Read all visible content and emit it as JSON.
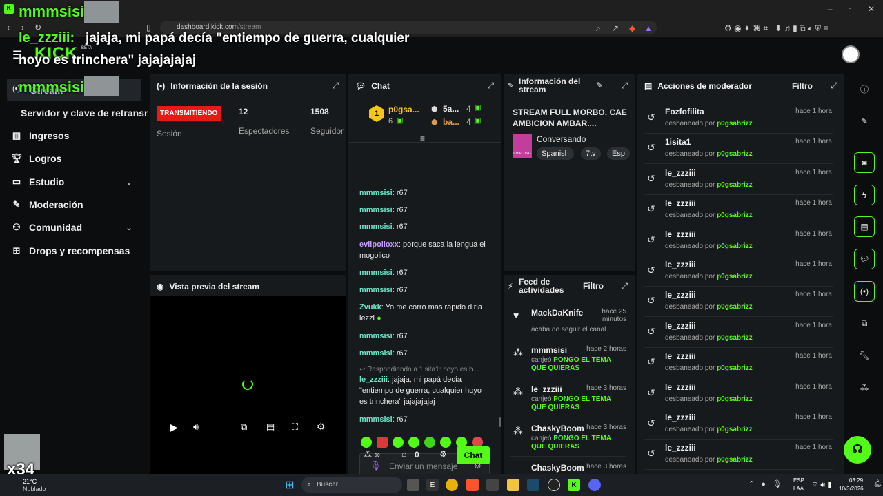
{
  "browser": {
    "url_prefix": "dashboard.kick.com",
    "url_path": "/stream"
  },
  "overlay": {
    "top_user": "mmmsisi:",
    "chat_user": "le_zzziii:",
    "chat_text_1": "jajaja, mi papá decía \"entiempo de guerra, cualquier",
    "chat_text_2": "hoyo es trinchera\" jajajajajaj",
    "mid_user": "mmmsisi:",
    "counter": "x34",
    "logo": "KICK",
    "logo_badge": "BETA"
  },
  "sidebar": {
    "stream_label": "Stream",
    "retransmision_label": "Servidor y clave de retransm",
    "items": [
      {
        "label": "Ingresos",
        "icon": "bar-chart-icon"
      },
      {
        "label": "Logros",
        "icon": "trophy-icon"
      },
      {
        "label": "Estudio",
        "icon": "studio-icon"
      },
      {
        "label": "Moderación",
        "icon": "wrench-icon"
      },
      {
        "label": "Comunidad",
        "icon": "people-icon"
      },
      {
        "label": "Drops y recompensas",
        "icon": "drops-icon"
      }
    ]
  },
  "session": {
    "title": "Información de la sesión",
    "status": "TRANSMITIENDO",
    "status_caption": "Sesión",
    "viewers_value": "12",
    "viewers_label": "Espectadores",
    "followers_value": "1508",
    "followers_label": "Seguidor"
  },
  "preview": {
    "title": "Vista previa del stream"
  },
  "chat": {
    "title": "Chat",
    "leader1_name": "p0gsa...",
    "leader1_count": "6",
    "leader2_name": "5a...",
    "leader2_count": "4",
    "leader3_name": "ba...",
    "leader3_count": "4",
    "messages": [
      {
        "user": "mmmsisi",
        "text": "r67"
      },
      {
        "user": "mmmsisi",
        "text": "r67"
      },
      {
        "user": "mmmsisi",
        "text": "r67"
      },
      {
        "user": "evilpolloxx",
        "text": "porque saca la lengua el mogolico"
      },
      {
        "user": "mmmsisi",
        "text": "r67"
      },
      {
        "user": "mmmsisi",
        "text": "r67"
      },
      {
        "user": "Zvukk",
        "text": "Yo me corro mas rapido diria lezzi"
      },
      {
        "user": "mmmsisi",
        "text": "r67"
      },
      {
        "user": "mmmsisi",
        "text": "r67"
      }
    ],
    "reply_hint": "Respondiendo a 1isita1: hoyo es h...",
    "reply_user": "le_zzziii",
    "reply_text": "jajaja, mi papá decía \"entiempo de guerra, cualquier hoyo es trinchera\" jajajajajaj",
    "last_user": "mmmsisi",
    "last_text": "r67",
    "input_placeholder": "Enviar un mensaje",
    "points": "0",
    "send_label": "Chat"
  },
  "stream_info": {
    "title": "Información del stream",
    "stream_title": "STREAM FULL MORBO. CAE AMBICION AMBAR....",
    "category": "Conversando",
    "category_thumb": "CHATTING",
    "tags": [
      "Spanish",
      "7tv",
      "Esp"
    ]
  },
  "feed": {
    "title": "Feed de actividades",
    "filter": "Filtro",
    "items": [
      {
        "name": "MackDaKnife",
        "time": "hace 25 minutos",
        "pre": "acaba de seguir el canal",
        "hl": ""
      },
      {
        "name": "mmmsisi",
        "time": "hace 2 horas",
        "pre": "canjeó",
        "hl": "PONGO EL TEMA QUE QUIERAS"
      },
      {
        "name": "le_zzziii",
        "time": "hace 3 horas",
        "pre": "canjeó",
        "hl": "PONGO EL TEMA QUE QUIERAS"
      },
      {
        "name": "ChaskyBoom",
        "time": "hace 3 horas",
        "pre": "canjeó",
        "hl": "PONGO EL TEMA QUE QUIERAS"
      },
      {
        "name": "ChaskyBoom",
        "time": "hace 3 horas",
        "pre": "",
        "hl": ""
      }
    ]
  },
  "mod_actions": {
    "title": "Acciones de moderador",
    "filter": "Filtro",
    "unban_prefix": "desbaneado por",
    "moderator": "p0gsabrizz",
    "rows": [
      {
        "user": "Fozfofilita",
        "time": "hace 1 hora"
      },
      {
        "user": "1isita1",
        "time": "hace 1 hora"
      },
      {
        "user": "le_zzziii",
        "time": "hace 1 hora"
      },
      {
        "user": "le_zzziii",
        "time": "hace 1 hora"
      },
      {
        "user": "le_zzziii",
        "time": "hace 1 hora"
      },
      {
        "user": "le_zzziii",
        "time": "hace 1 hora"
      },
      {
        "user": "le_zzziii",
        "time": "hace 1 hora"
      },
      {
        "user": "le_zzziii",
        "time": "hace 1 hora"
      },
      {
        "user": "le_zzziii",
        "time": "hace 1 hora"
      },
      {
        "user": "le_zzziii",
        "time": "hace 1 hora"
      },
      {
        "user": "le_zzziii",
        "time": "hace 1 hora"
      },
      {
        "user": "le_zzziii",
        "time": "hace 1 hora"
      }
    ]
  },
  "taskbar": {
    "weather_temp": "21°C",
    "weather_desc": "Nublado",
    "search_placeholder": "Buscar",
    "lang_1": "ESP",
    "lang_2": "LAA",
    "time": "03:29",
    "date": "10/3/2026"
  },
  "colors": {
    "accent": "#53fc18",
    "live": "#e91916",
    "panel": "#171a1c",
    "bg": "#0b0d0f"
  }
}
